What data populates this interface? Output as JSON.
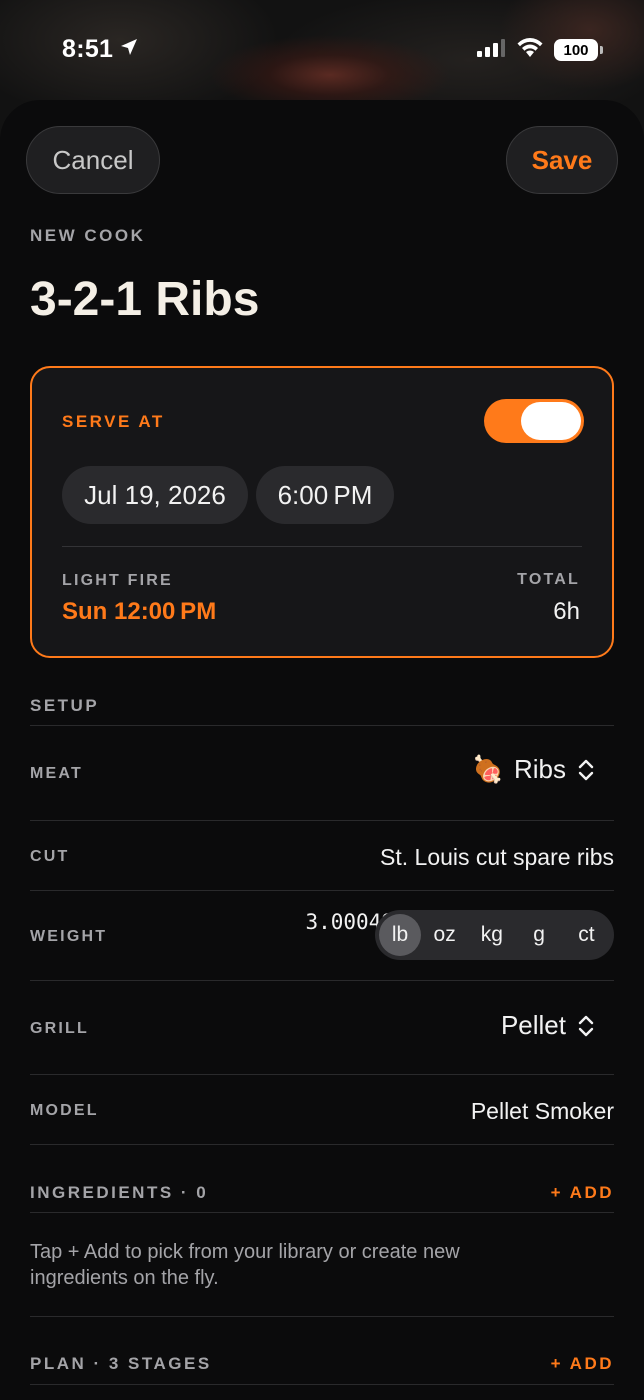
{
  "status": {
    "time": "8:51",
    "battery": "100"
  },
  "nav": {
    "cancel_label": "Cancel",
    "save_label": "Save"
  },
  "header": {
    "eyebrow": "NEW COOK",
    "title": "3-2-1 Ribs"
  },
  "serve": {
    "label": "SERVE AT",
    "enabled": true,
    "date": "Jul 19, 2026",
    "time": "6:00 PM",
    "light_fire_label": "LIGHT FIRE",
    "light_fire_value": "Sun 12:00 PM",
    "total_label": "TOTAL",
    "total_value": "6h"
  },
  "setup": {
    "label": "SETUP",
    "meat_label": "MEAT",
    "meat_emoji": "🍖",
    "meat_value": "Ribs",
    "cut_label": "CUT",
    "cut_value": "St. Louis cut spare ribs",
    "weight_label": "WEIGHT",
    "weight_value": "3.00049",
    "units": [
      "lb",
      "oz",
      "kg",
      "g",
      "ct"
    ],
    "selected_unit": "lb",
    "grill_label": "GRILL",
    "grill_value": "Pellet",
    "model_label": "MODEL",
    "model_value": "Pellet Smoker"
  },
  "ingredients": {
    "label": "INGREDIENTS · 0",
    "add_label": "+ ADD",
    "helper": "Tap + Add to pick from your library or create new ingredients on the fly."
  },
  "plan": {
    "label": "PLAN · 3 STAGES",
    "add_label": "+ ADD"
  },
  "colors": {
    "accent": "#ff7a1a",
    "background": "#0b0b0c",
    "card": "#161618"
  },
  "icons": [
    "location-arrow-icon",
    "cellular-signal-icon",
    "wifi-icon",
    "battery-icon",
    "meat-icon",
    "chevron-up-down-icon"
  ]
}
